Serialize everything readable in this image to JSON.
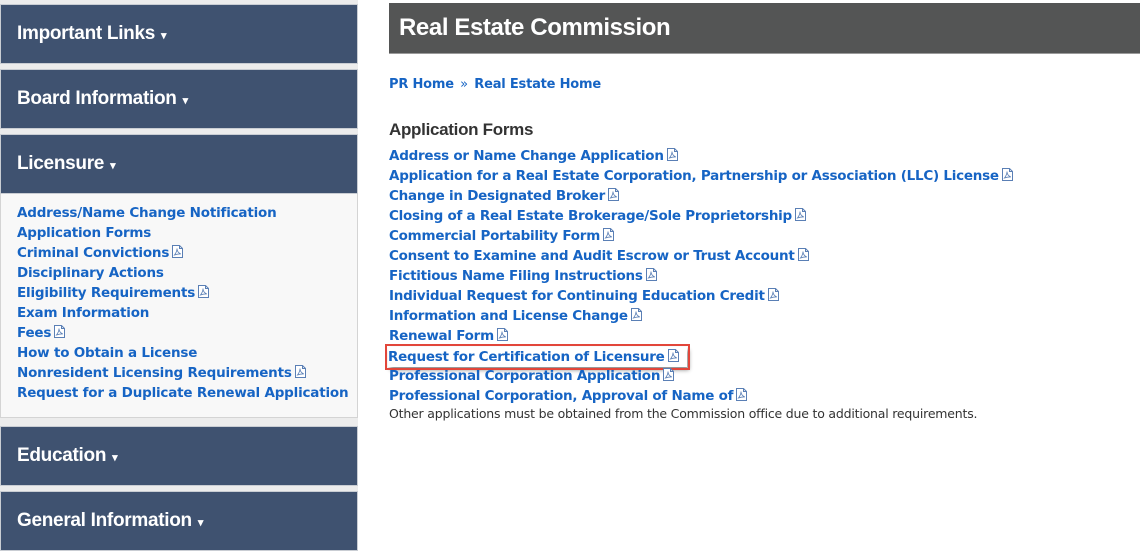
{
  "sidebar": {
    "panels": [
      {
        "label": "Important Links",
        "expanded": false
      },
      {
        "label": "Board Information",
        "expanded": false
      },
      {
        "label": "Licensure",
        "expanded": true
      },
      {
        "label": "Education",
        "expanded": false
      },
      {
        "label": "General Information",
        "expanded": false
      }
    ],
    "caret_glyph": "▾",
    "licensure_links": [
      {
        "label": "Address/Name Change Notification",
        "pdf": false
      },
      {
        "label": "Application Forms",
        "pdf": false
      },
      {
        "label": "Criminal Convictions",
        "pdf": true
      },
      {
        "label": "Disciplinary Actions",
        "pdf": false
      },
      {
        "label": "Eligibility Requirements",
        "pdf": true
      },
      {
        "label": "Exam Information",
        "pdf": false
      },
      {
        "label": "Fees",
        "pdf": true
      },
      {
        "label": "How to Obtain a License",
        "pdf": false
      },
      {
        "label": "Nonresident Licensing Requirements",
        "pdf": true
      },
      {
        "label": "Request for a Duplicate Renewal Application",
        "pdf": false
      }
    ]
  },
  "main": {
    "title": "Real Estate Commission",
    "breadcrumb": {
      "items": [
        "PR Home",
        "Real Estate Home"
      ],
      "separator": "»"
    },
    "section_title": "Application Forms",
    "forms": [
      {
        "label": "Address or Name Change Application",
        "pdf": true
      },
      {
        "label": "Application for a Real Estate Corporation, Partnership or Association (LLC) License",
        "pdf": true
      },
      {
        "label": "Change in Designated Broker",
        "pdf": true
      },
      {
        "label": "Closing of a Real Estate Brokerage/Sole Proprietorship",
        "pdf": true
      },
      {
        "label": "Commercial Portability Form",
        "pdf": true
      },
      {
        "label": "Consent to Examine and Audit Escrow or Trust Account",
        "pdf": true
      },
      {
        "label": "Fictitious Name Filing Instructions",
        "pdf": true
      },
      {
        "label": "Individual Request for Continuing Education Credit",
        "pdf": true
      },
      {
        "label": "Information and License Change",
        "pdf": true
      },
      {
        "label": "Renewal Form",
        "pdf": true
      },
      {
        "label": "Request for Certification of Licensure",
        "pdf": true,
        "highlighted": true
      },
      {
        "label": "Professional Corporation Application",
        "pdf": true
      },
      {
        "label": "Professional Corporation, Approval of Name of",
        "pdf": true
      }
    ],
    "note": "Other applications must be obtained from the Commission office due to additional requirements."
  },
  "colors": {
    "panel_header": "#3f5270",
    "title_bar": "#545555",
    "link": "#1664c4",
    "highlight_border": "#e2463a"
  }
}
